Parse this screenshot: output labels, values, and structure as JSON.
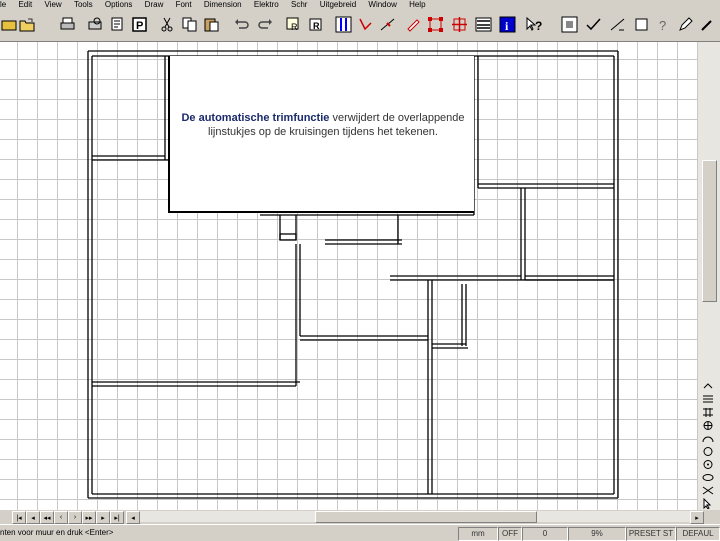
{
  "menu": [
    "le",
    "Edit",
    "View",
    "Tools",
    "Options",
    "Draw",
    "Font",
    "Dimension",
    "Elektro",
    "Schr",
    "Uitgebreid",
    "Window",
    "Help"
  ],
  "toolbar": {
    "icons": [
      "open-icon",
      "folder-icon",
      "print-icon",
      "print-preview-icon",
      "bold-p-icon",
      "cut-icon",
      "copy-icon",
      "paste-icon",
      "undo-icon",
      "redo-icon",
      "rectangle-r-icon",
      "rotate-r-icon",
      "columns-icon",
      "angle-arrow-icon",
      "node-icon",
      "select-nodes-icon",
      "move-icon",
      "list-icon",
      "info-icon",
      "help-cursor-icon",
      "snap-icon",
      "check-icon",
      "line-icon",
      "box-icon",
      "question-icon",
      "pen-icon"
    ]
  },
  "callout": {
    "bold_text": "De automatische trimfunctie",
    "rest_text": " verwijdert de overlappende lijnstukjes op de kruisingen tijdens het tekenen."
  },
  "statusbar": {
    "prompt": "nten voor muur en druk <Enter>",
    "unit": "mm",
    "ortho": "OFF",
    "angle": "0",
    "zoom": "9%",
    "mode": "PRESET ST",
    "layer": "DEFAUL"
  },
  "colors": {
    "accent": "#1a2a6c",
    "grid": "#c8c8c8",
    "chrome": "#d4d0c8"
  }
}
